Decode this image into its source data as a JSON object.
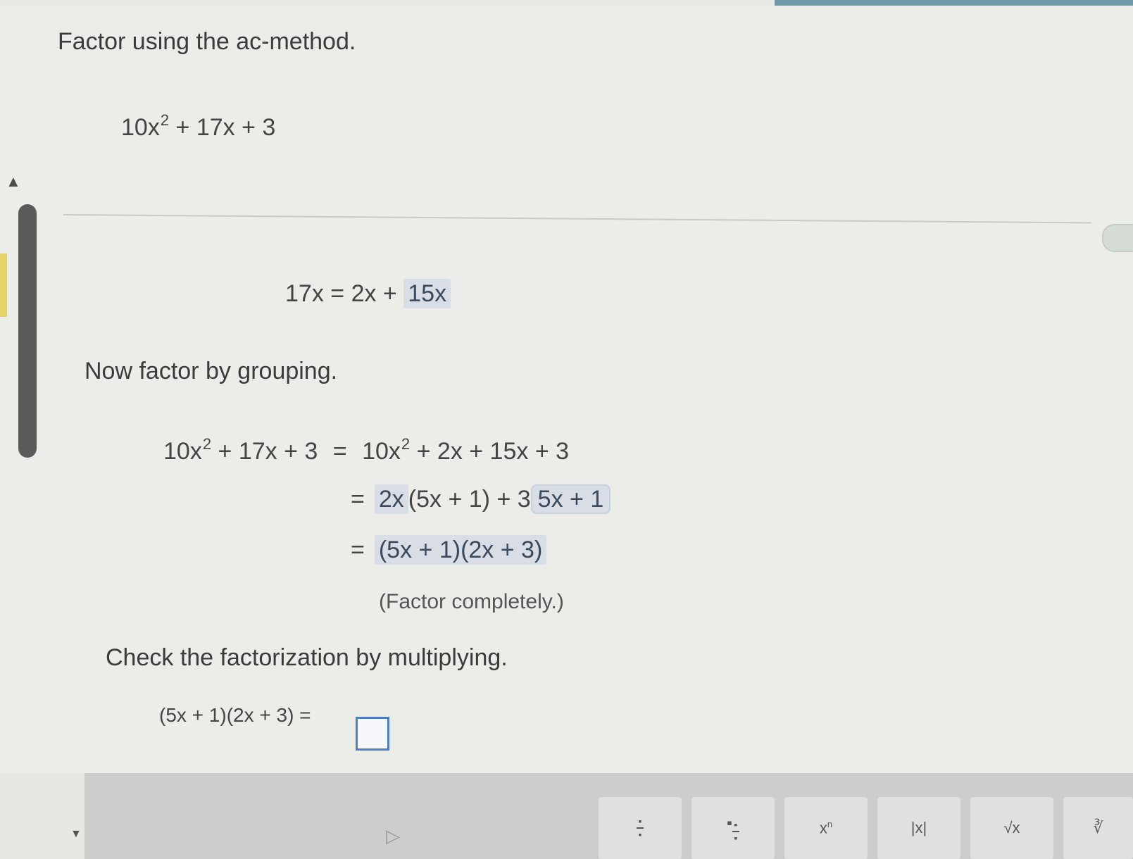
{
  "prompt": {
    "instruction": "Factor using the ac-method.",
    "polynomial": {
      "a": "10x",
      "exp": "2",
      "rest": " + 17x + 3"
    }
  },
  "split": {
    "lhs": "17x",
    "eq": " = ",
    "part1": "2x + ",
    "part2": "15x"
  },
  "grouping": {
    "instruction": "Now factor by grouping.",
    "line1": {
      "lhs_a": "10x",
      "lhs_exp": "2",
      "lhs_rest": " + 17x + 3",
      "eq": "=",
      "rhs_a": "10x",
      "rhs_exp": "2",
      "rhs_rest": " + 2x + 15x + 3"
    },
    "line2": {
      "eq": "=",
      "ans1": "2x",
      "mid": "(5x + 1) + 3",
      "ans2": "5x + 1"
    },
    "line3": {
      "eq": "=",
      "ans": "(5x + 1)(2x + 3)"
    },
    "note": "(Factor completely.)"
  },
  "check": {
    "instruction": "Check the factorization by multiplying.",
    "expression": "(5x + 1)(2x + 3) ="
  },
  "toolbar": {
    "buttons": [
      "fraction-button",
      "mixed-number-button",
      "exponent-button",
      "absolute-value-button",
      "sqrt-button"
    ],
    "exponent_label": "x",
    "exponent_sup": "n",
    "abs_label": "|x|",
    "sqrt_label": "√x"
  }
}
